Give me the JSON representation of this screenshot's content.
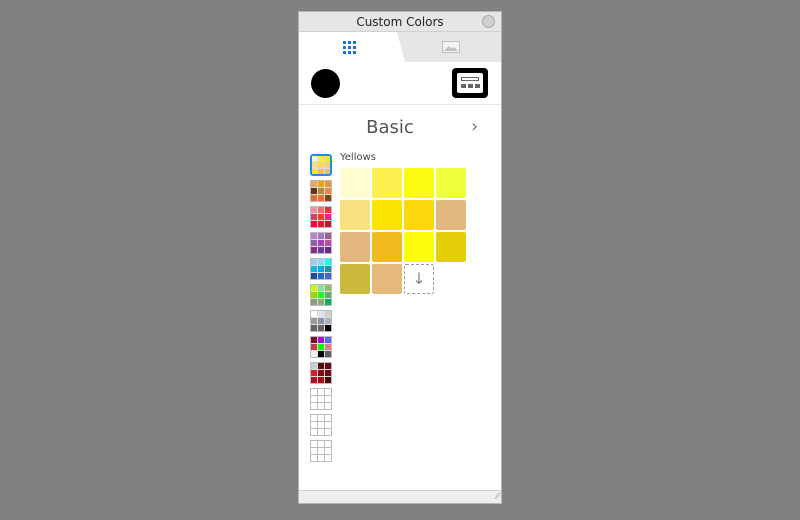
{
  "window": {
    "title": "Custom Colors"
  },
  "tabs": [
    {
      "name": "swatches",
      "icon": "grid-icon",
      "active": true
    },
    {
      "name": "image",
      "icon": "image-icon",
      "active": false
    }
  ],
  "current_color": "#000000",
  "section": {
    "title": "Basic",
    "next_icon": "chevron-right-icon",
    "chevron": "›"
  },
  "group": {
    "label": "Yellows"
  },
  "add_icon": "↓",
  "grip": "⁄⁄",
  "side_swatches": [
    [
      "#fff9c0",
      "#fbec3a",
      "#fbe30a",
      "#f8e07a",
      "#fbd84f",
      "#f2d35a",
      "#fbe016",
      "#f2bb6c",
      "#e5b97c"
    ],
    [
      "#e9a75e",
      "#f4a10f",
      "#e49a3a",
      "#6b3213",
      "#b98a3b",
      "#ee8440",
      "#e0702c",
      "#e6702e",
      "#7f4812"
    ],
    [
      "#f58da7",
      "#ee6f73",
      "#e0383f",
      "#e03b61",
      "#ff3d1f",
      "#ff1a8e",
      "#ff0038",
      "#e5143d",
      "#c4172b"
    ],
    [
      "#b684c8",
      "#9f78bf",
      "#a05c93",
      "#8e5fab",
      "#ab3eb4",
      "#b5509f",
      "#872b8b",
      "#6c3a9f",
      "#612e8c"
    ],
    [
      "#a5cae9",
      "#89d9f0",
      "#1ef4f2",
      "#13b5e8",
      "#00a9e8",
      "#1898ad",
      "#1c4b9d",
      "#1f6cbf",
      "#4568d0"
    ],
    [
      "#c4f81a",
      "#88dc9c",
      "#95bd6b",
      "#9ad00f",
      "#10ff1f",
      "#5bb161",
      "#8a9a80",
      "#8cab79",
      "#14ad63"
    ],
    [
      "#ffffff",
      "#dde3ec",
      "#cfd1c7",
      "#9d9c9b",
      "#8a91a6",
      "#a8b1c2",
      "#67625f",
      "#71635c",
      "#000000"
    ],
    [
      "#7d0f2a",
      "#a80fe4",
      "#4f6ff0",
      "#c13b44",
      "#10f713",
      "#e17f82",
      "#f7eef1",
      "#030303",
      "#585f69"
    ],
    [
      "#c8cdd5",
      "#590a0d",
      "#6c0715",
      "#d81d31",
      "#7c0a11",
      "#720612",
      "#b70e25",
      "#a10c15",
      "#4c0507"
    ],
    "empty",
    "empty",
    "empty"
  ],
  "colors": [
    "#fffcd1",
    "#fdef4d",
    "#fbfa0f",
    "#eeff3c",
    "#f8df7f",
    "#fde400",
    "#fdd70e",
    "#e2b87e",
    "#e2b67c",
    "#f2ba1f",
    "#fcfe0d",
    "#e5cd07",
    "#ccb83d",
    "#e5b87b"
  ]
}
